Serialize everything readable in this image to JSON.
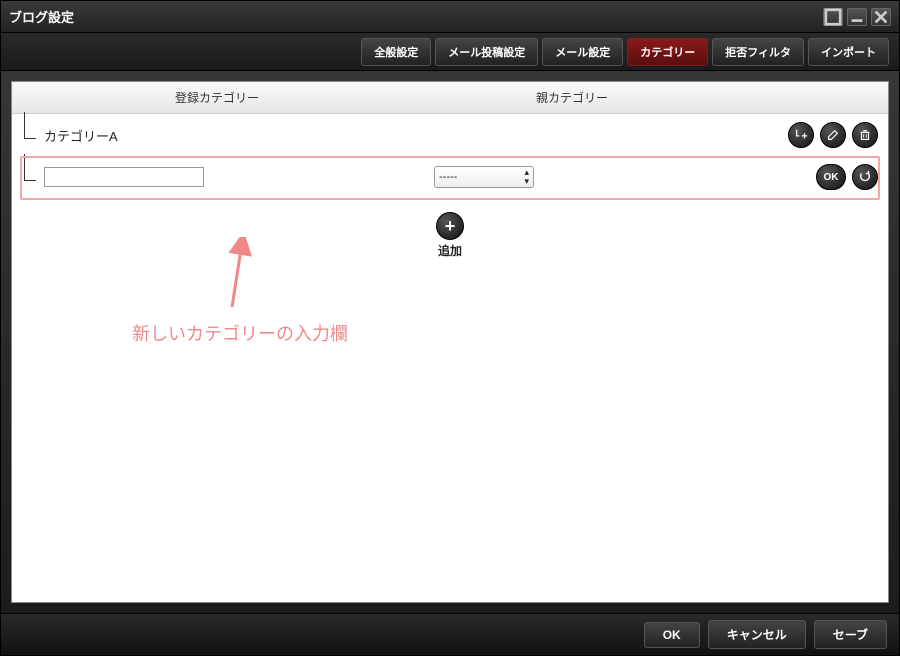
{
  "window": {
    "title": "ブログ設定"
  },
  "tabs": {
    "general": "全般設定",
    "mail_post": "メール投稿設定",
    "mail": "メール設定",
    "category": "カテゴリー",
    "filter": "拒否フィルタ",
    "import": "インポート"
  },
  "table": {
    "col_registered": "登録カテゴリー",
    "col_parent": "親カテゴリー"
  },
  "rows": [
    {
      "name": "カテゴリーA"
    }
  ],
  "input_row": {
    "value": "",
    "select_value": "-----",
    "ok_label": "OK"
  },
  "add": {
    "label": "追加"
  },
  "annotation": {
    "text": "新しいカテゴリーの入力欄"
  },
  "footer": {
    "ok": "OK",
    "cancel": "キャンセル",
    "save": "セーブ"
  }
}
